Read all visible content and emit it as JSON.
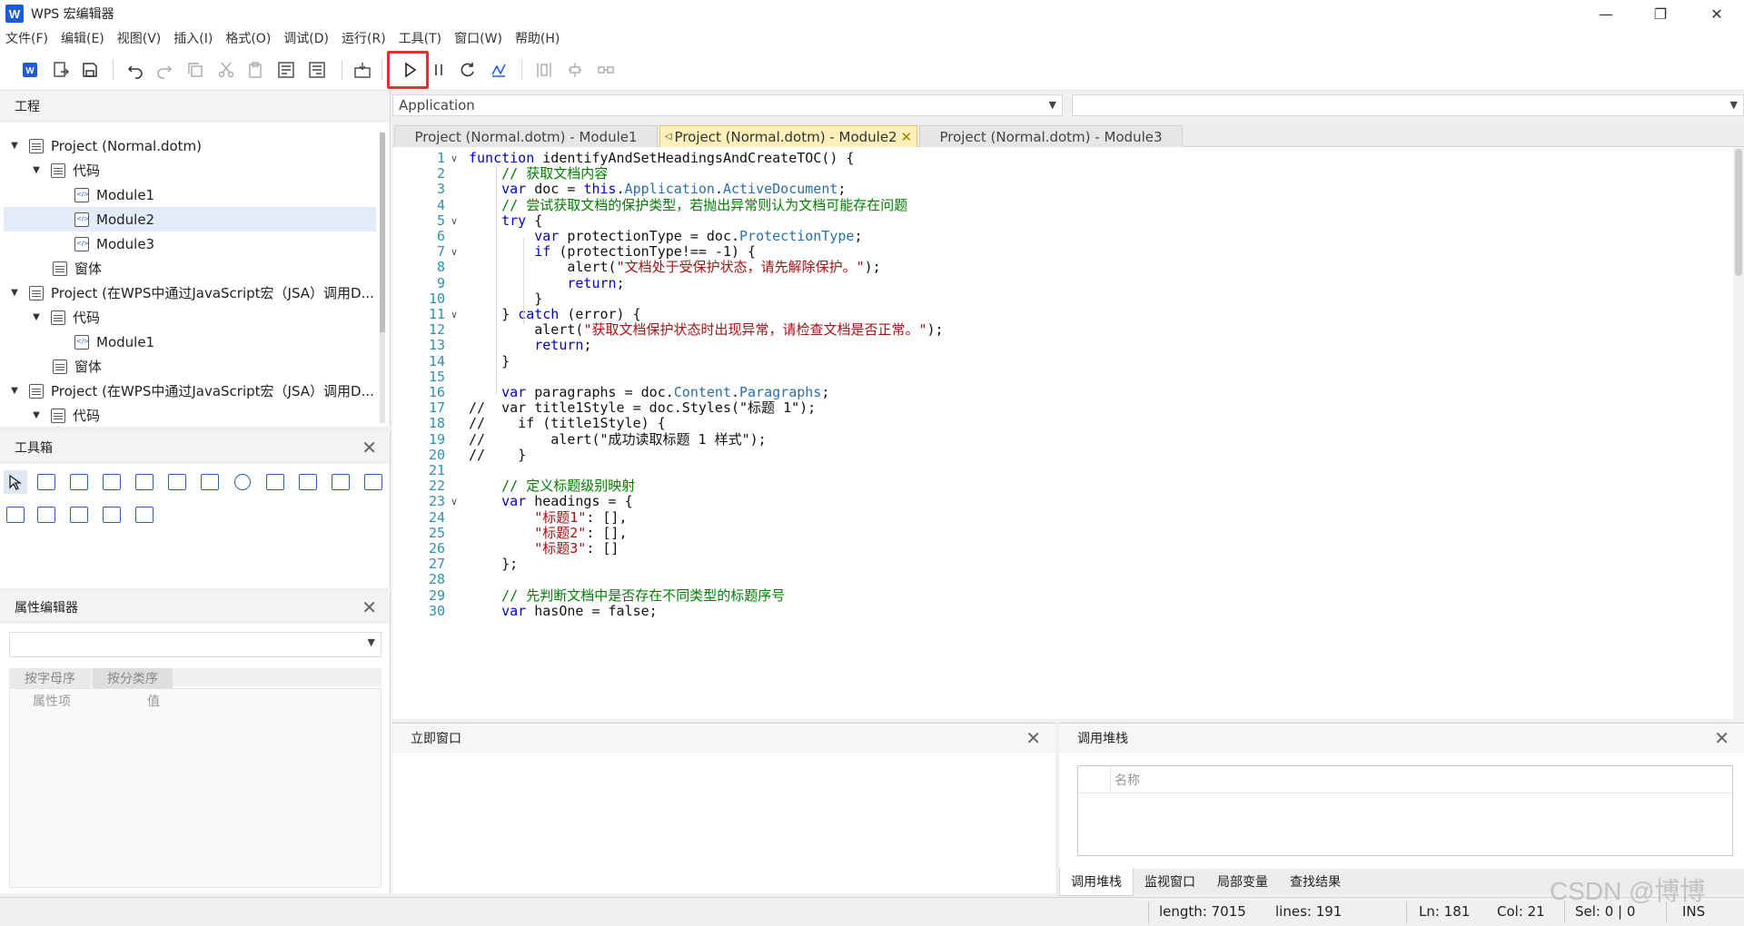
{
  "window": {
    "title": "WPS 宏编辑器",
    "app_icon": "W"
  },
  "menu": [
    "文件(F)",
    "编辑(E)",
    "视图(V)",
    "插入(I)",
    "格式(O)",
    "调试(D)",
    "运行(R)",
    "工具(T)",
    "窗口(W)",
    "帮助(H)"
  ],
  "project_panel": {
    "title": "工程",
    "tree": [
      {
        "label": "Project (Normal.dotm)",
        "type": "project"
      },
      {
        "label": "代码",
        "type": "folder"
      },
      {
        "label": "Module1",
        "type": "module"
      },
      {
        "label": "Module2",
        "type": "module",
        "selected": true
      },
      {
        "label": "Module3",
        "type": "module"
      },
      {
        "label": "窗体",
        "type": "form"
      },
      {
        "label": "Project (在WPS中通过JavaScript宏（JSA）调用D...",
        "type": "project"
      },
      {
        "label": "代码",
        "type": "folder"
      },
      {
        "label": "Module1",
        "type": "module"
      },
      {
        "label": "窗体",
        "type": "form"
      },
      {
        "label": "Project (在WPS中通过JavaScript宏（JSA）调用D...",
        "type": "project"
      },
      {
        "label": "代码",
        "type": "folder"
      }
    ]
  },
  "toolbox": {
    "title": "工具箱"
  },
  "property_editor": {
    "title": "属性编辑器",
    "tabs": [
      "按字母序",
      "按分类序"
    ],
    "columns": [
      "属性项",
      "值"
    ]
  },
  "editor": {
    "object_combo": "Application",
    "tabs": [
      "Project (Normal.dotm) - Module1",
      "Project (Normal.dotm) - Module2",
      "Project (Normal.dotm) - Module3"
    ],
    "active_tab": 1,
    "line_numbers": [
      "1",
      "2",
      "3",
      "4",
      "5",
      "6",
      "7",
      "8",
      "9",
      "10",
      "11",
      "12",
      "13",
      "14",
      "15",
      "16",
      "17",
      "18",
      "19",
      "20",
      "21",
      "22",
      "23",
      "24",
      "25",
      "26",
      "27",
      "28",
      "29",
      "30"
    ],
    "code_lines": [
      "function identifyAndSetHeadingsAndCreateTOC() {",
      "    // 获取文档内容",
      "    var doc = this.Application.ActiveDocument;",
      "    // 尝试获取文档的保护类型，若抛出异常则认为文档可能存在问题",
      "    try {",
      "        var protectionType = doc.ProtectionType;",
      "        if (protectionType!== -1) {",
      "            alert(\"文档处于受保护状态，请先解除保护。\");",
      "            return;",
      "        }",
      "    } catch (error) {",
      "        alert(\"获取文档保护状态时出现异常，请检查文档是否正常。\");",
      "        return;",
      "    }",
      "",
      "    var paragraphs = doc.Content.Paragraphs;",
      "//  var title1Style = doc.Styles(\"标题 1\");",
      "//    if (title1Style) {",
      "//        alert(\"成功读取标题 1 样式\");",
      "//    }",
      "",
      "    // 定义标题级别映射",
      "    var headings = {",
      "        \"标题1\": [],",
      "        \"标题2\": [],",
      "        \"标题3\": []",
      "    };",
      "",
      "    // 先判断文档中是否存在不同类型的标题序号",
      "    var hasOne = false;"
    ]
  },
  "immediate": {
    "title": "立即窗口"
  },
  "callstack": {
    "title": "调用堆栈",
    "column": "名称",
    "tabs": [
      "调用堆栈",
      "监视窗口",
      "局部变量",
      "查找结果"
    ]
  },
  "status": {
    "length": "length: 7015",
    "lines": "lines: 191",
    "ln": "Ln: 181",
    "col": "Col: 21",
    "sel": "Sel: 0 | 0",
    "mode": "INS"
  },
  "watermark": "CSDN @博博",
  "colors": {
    "highlight": "#e53030",
    "accent": "#1e5bd6",
    "active_tab": "#fdf0b8"
  }
}
